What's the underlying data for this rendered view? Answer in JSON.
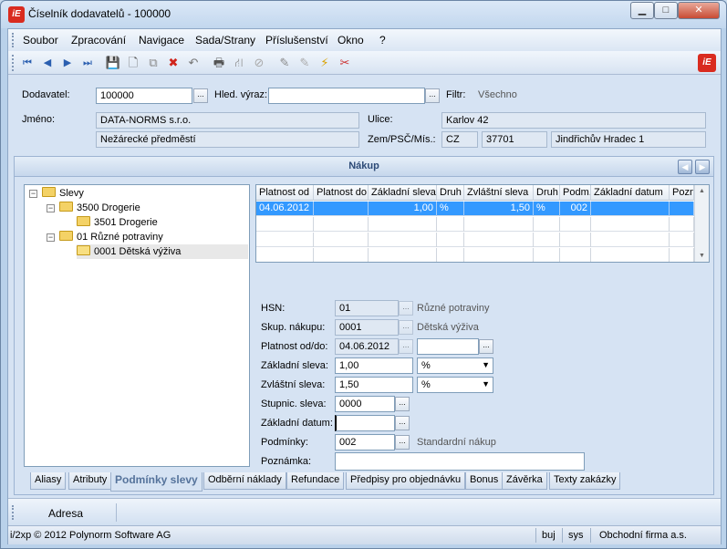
{
  "window": {
    "title": "Číselník dodavatelů - 100000",
    "logo_text": "iE",
    "min_glyph": "▁",
    "max_glyph": "□",
    "close_glyph": "✕"
  },
  "menu": [
    "Soubor",
    "Zpracování",
    "Navigace",
    "Sada/Strany",
    "Příslušenství",
    "Okno",
    "?"
  ],
  "toolbar": {
    "icons": [
      "first-record-icon",
      "prev-record-icon",
      "next-record-icon",
      "last-record-icon",
      "save-icon",
      "new-document-icon",
      "copy-icon",
      "delete-icon",
      "undo-icon",
      "print-icon",
      "tree-icon",
      "disabled-icon",
      "edit-icon",
      "edit-disabled-icon",
      "wizard-icon",
      "tools-icon"
    ],
    "glyphs": [
      "⏮",
      "◀",
      "▶",
      "⏭",
      "💾",
      "🗋",
      "⧉",
      "✖",
      "↶",
      "🖶",
      "⛙",
      "⊘",
      "✎",
      "✎",
      "⚡",
      "✂"
    ]
  },
  "header": {
    "supplier_label": "Dodavatel:",
    "supplier_value": "100000",
    "search_label": "Hled. výraz:",
    "search_value": "",
    "filter_label": "Filtr:",
    "filter_value": "Všechno",
    "name_label": "Jméno:",
    "name_value": "DATA-NORMS s.r.o.",
    "name2_value": "Nežárecké předměstí",
    "street_label": "Ulice:",
    "street_value": "Karlov 42",
    "zip_label": "Zem/PSČ/Mís.:",
    "country_value": "CZ",
    "zip_value": "37701",
    "city_value": "Jindřichův Hradec 1",
    "dots": "..."
  },
  "section": {
    "title": "Nákup",
    "prev_glyph": "◀",
    "next_glyph": "▶"
  },
  "tree": {
    "root": "Slevy",
    "items": [
      {
        "label": "3500  Drogerie"
      },
      {
        "label": "3501  Drogerie"
      },
      {
        "label": "01  Různé potraviny"
      },
      {
        "label": "0001  Dětská výživa"
      }
    ]
  },
  "grid": {
    "columns": [
      "Platnost od",
      "Platnost do",
      "Základní sleva",
      "Druh",
      "Zvláštní sleva",
      "Druh",
      "Podm.",
      "Základní datum",
      "Pozn"
    ],
    "rows": [
      [
        "04.06.2012",
        "",
        "1,00",
        "%",
        "1,50",
        "%",
        "002",
        "",
        ""
      ]
    ],
    "scroll_up": "▲",
    "scroll_down": "▼"
  },
  "form": {
    "hsn_label": "HSN:",
    "hsn_value": "01",
    "hsn_desc": "Různé potraviny",
    "group_label": "Skup. nákupu:",
    "group_value": "0001",
    "group_desc": "Dětská výživa",
    "validity_label": "Platnost od/do:",
    "valid_from": "04.06.2012",
    "valid_to": "",
    "base_discount_label": "Základní sleva:",
    "base_discount": "1,00",
    "base_discount_type": "%",
    "special_discount_label": "Zvláštní sleva:",
    "special_discount": "1,50",
    "special_discount_type": "%",
    "tier_label": "Stupnic. sleva:",
    "tier_value": "0000",
    "base_date_label": "Základní datum:",
    "base_date_value": "",
    "conditions_label": "Podmínky:",
    "conditions_value": "002",
    "conditions_desc": "Standardní nákup",
    "note_label": "Poznámka:",
    "note_value": "",
    "dots": "...",
    "arrow": "▼"
  },
  "tabs": [
    "Aliasy",
    "Atributy",
    "Podmínky slevy",
    "Odběrní náklady",
    "Refundace",
    "Předpisy pro objednávku",
    "Bonus",
    "Závěrka",
    "Texty zakázky"
  ],
  "active_tab": "Podmínky slevy",
  "address_bar": {
    "label": "Adresa"
  },
  "status": {
    "copyright": "i/2xp © 2012 Polynorm Software AG",
    "user": "buj",
    "system": "sys",
    "company": "Obchodní firma a.s."
  },
  "colors": {
    "brand": "#d92b1f",
    "selection": "#3399ff",
    "header_blue": "#2c4a77"
  }
}
